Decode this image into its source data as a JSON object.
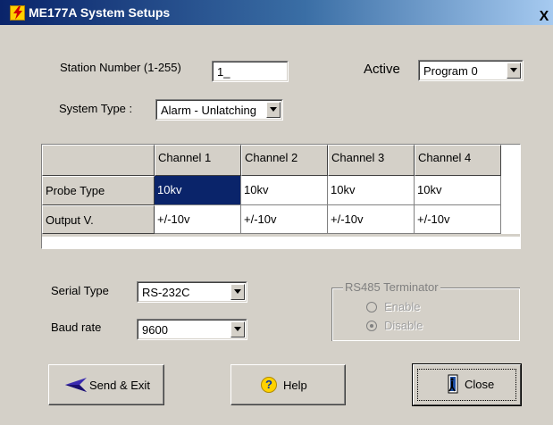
{
  "window": {
    "title": "ME177A System Setups",
    "close_glyph": "X",
    "icon": "lightning-icon"
  },
  "station": {
    "label": "Station Number (1-255)",
    "value": "1_"
  },
  "active": {
    "label": "Active",
    "value": "Program 0"
  },
  "system_type": {
    "label": "System Type :",
    "value": "Alarm - Unlatching"
  },
  "grid": {
    "columns": [
      "Channel 1",
      "Channel 2",
      "Channel 3",
      "Channel 4"
    ],
    "rows": [
      {
        "label": "Probe Type",
        "cells": [
          "10kv",
          "10kv",
          "10kv",
          "10kv"
        ]
      },
      {
        "label": "Output V.",
        "cells": [
          "+/-10v",
          "+/-10v",
          "+/-10v",
          "+/-10v"
        ]
      }
    ],
    "selected_cell": "Probe Type / Channel 1"
  },
  "serial": {
    "label": "Serial Type",
    "value": "RS-232C"
  },
  "baud": {
    "label": "Baud rate",
    "value": "9600"
  },
  "terminator": {
    "title": "RS485 Terminator",
    "options": [
      "Enable",
      "Disable"
    ],
    "selected": "Disable"
  },
  "buttons": {
    "send_exit": "Send & Exit",
    "help": "Help",
    "close": "Close"
  },
  "colors": {
    "title_start": "#0a246a",
    "title_end": "#a6caf0",
    "dialog_face": "#d4d0c8",
    "selection": "#0a246a"
  }
}
